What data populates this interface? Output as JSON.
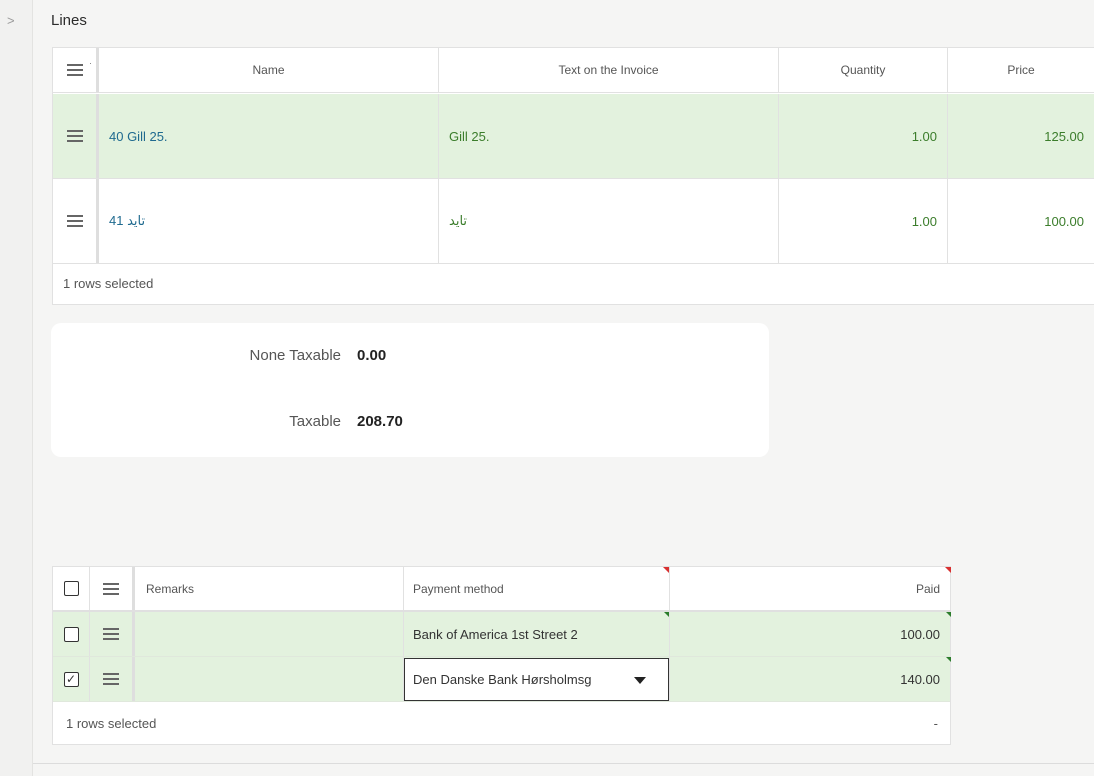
{
  "rail": {
    "chevron": ">"
  },
  "lines_section": {
    "title": "Lines"
  },
  "lines_grid": {
    "columns": [
      "Name",
      "Text on the Invoice",
      "Quantity",
      "Price"
    ],
    "rows": [
      {
        "name": "40 Gill 25.",
        "text": "Gill 25.",
        "quantity": "1.00",
        "price": "125.00",
        "selected": true
      },
      {
        "name": "41 تايد",
        "text": "تايد",
        "quantity": "1.00",
        "price": "100.00",
        "selected": false
      }
    ],
    "footer": "1 rows selected"
  },
  "totals": {
    "none_taxable_label": "None Taxable",
    "none_taxable_value": "0.00",
    "taxable_label": "Taxable",
    "taxable_value": "208.70"
  },
  "payments_grid": {
    "columns": [
      "Remarks",
      "Payment method",
      "Paid"
    ],
    "rows": [
      {
        "remarks": "",
        "payment_method": "Bank of America 1st Street 2",
        "paid": "100.00",
        "checked": false
      },
      {
        "remarks": "",
        "payment_method": "Den Danske Bank Hørsholmsg",
        "paid": "140.00",
        "checked": true
      }
    ],
    "footer": "1 rows selected",
    "footer_total": "-"
  },
  "icons": {
    "row_menu": "hamburger-icon",
    "checkbox_checked": "✓"
  }
}
